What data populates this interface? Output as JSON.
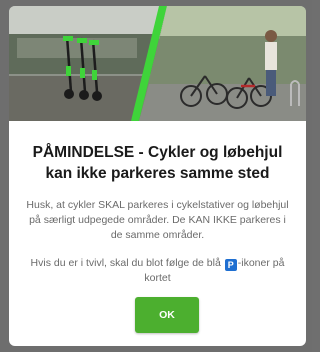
{
  "dialog": {
    "title": "PÅMINDELSE - Cykler og løbehjul kan ikke parkeres samme sted",
    "body_paragraph_1": "Husk, at cykler SKAL parkeres i cykelstativer og løbehjul på særligt udpegede områder. De KAN IKKE parkeres i de samme områder.",
    "body_paragraph_2_before_icon": "Hvis du er i tvivl, skal du blot følge de blå",
    "parking_icon_letter": "P",
    "body_paragraph_2_after_icon": "-ikoner på kortet",
    "ok_label": "OK"
  },
  "colors": {
    "accent_green": "#4caf2f",
    "parking_blue": "#1f6fd1",
    "backdrop": "#6e6e6e"
  },
  "hero_image": {
    "icon": "scooters-and-bicycles-photo"
  }
}
